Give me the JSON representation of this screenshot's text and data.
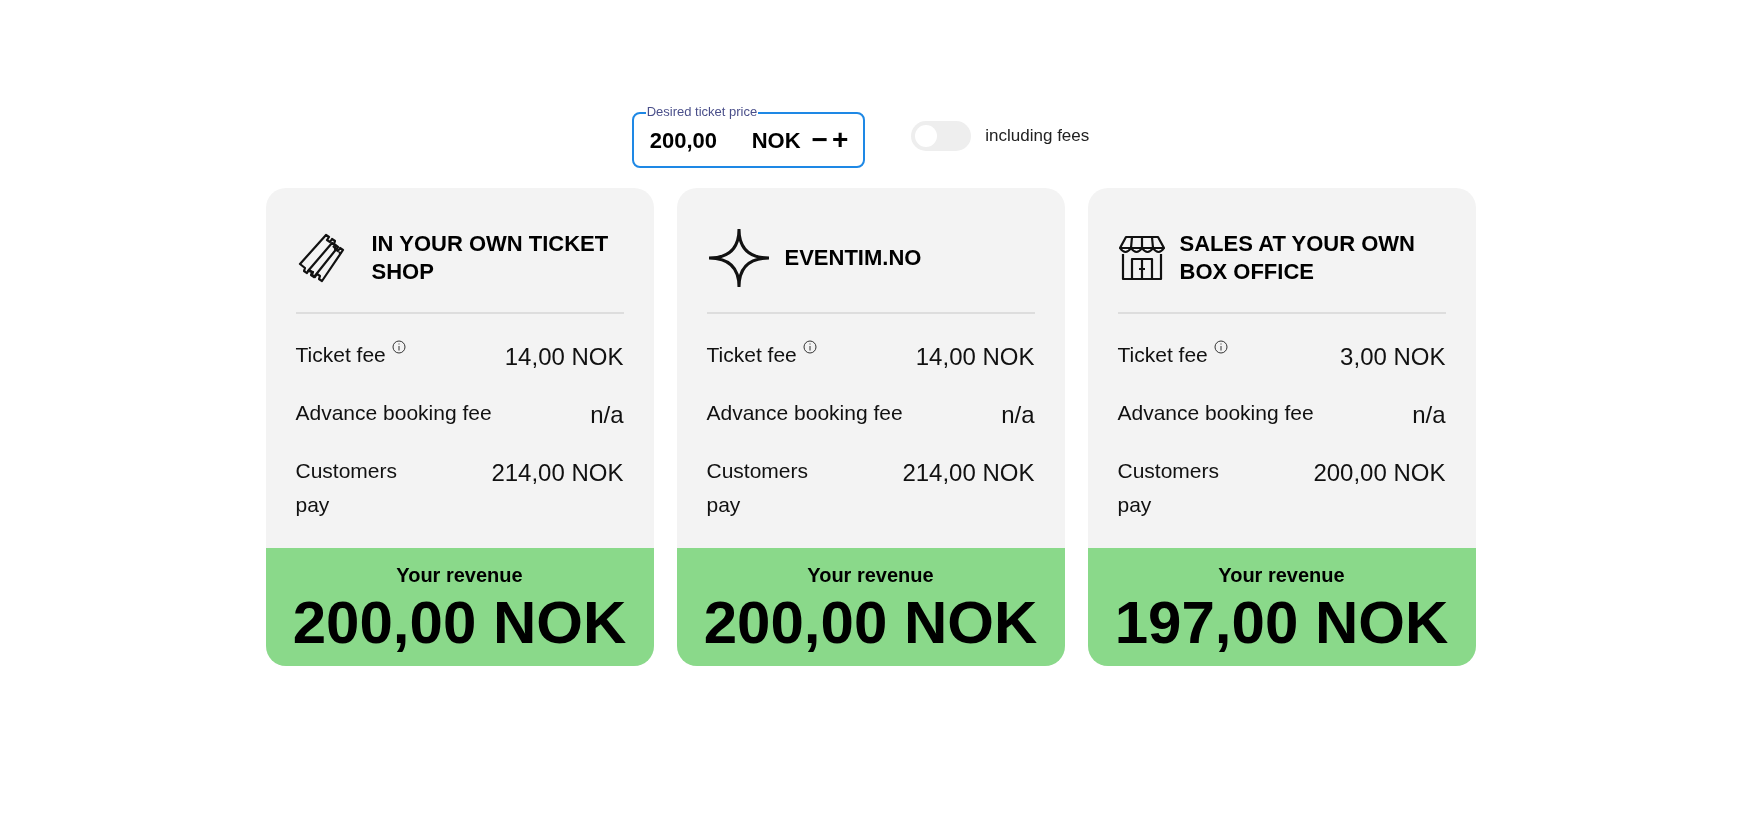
{
  "price_field": {
    "label": "Desired ticket price",
    "value": "200,00",
    "currency": "NOK",
    "minus": "−",
    "plus": "+"
  },
  "fees_toggle": {
    "on": false,
    "label": "including fees"
  },
  "cards": [
    {
      "kind": "ticket",
      "title": "IN YOUR OWN TICKET SHOP",
      "rows": [
        {
          "label": "Ticket fee",
          "info": true,
          "value": "14,00 NOK"
        },
        {
          "label": "Advance booking fee",
          "info": false,
          "value": "n/a"
        },
        {
          "label": "Customers pay",
          "info": false,
          "value": "214,00 NOK"
        }
      ],
      "revenue_label": "Your revenue",
      "revenue": "200,00 NOK"
    },
    {
      "kind": "star",
      "title": "EVENTIM.NO",
      "rows": [
        {
          "label": "Ticket fee",
          "info": true,
          "value": "14,00 NOK"
        },
        {
          "label": "Advance booking fee",
          "info": false,
          "value": "n/a"
        },
        {
          "label": "Customers pay",
          "info": false,
          "value": "214,00 NOK"
        }
      ],
      "revenue_label": "Your revenue",
      "revenue": "200,00 NOK"
    },
    {
      "kind": "store",
      "title": "SALES AT YOUR OWN BOX OFFICE",
      "rows": [
        {
          "label": "Ticket fee",
          "info": true,
          "value": "3,00 NOK"
        },
        {
          "label": "Advance booking fee",
          "info": false,
          "value": "n/a"
        },
        {
          "label": "Customers pay",
          "info": false,
          "value": "200,00 NOK"
        }
      ],
      "revenue_label": "Your revenue",
      "revenue": "197,00 NOK"
    }
  ]
}
